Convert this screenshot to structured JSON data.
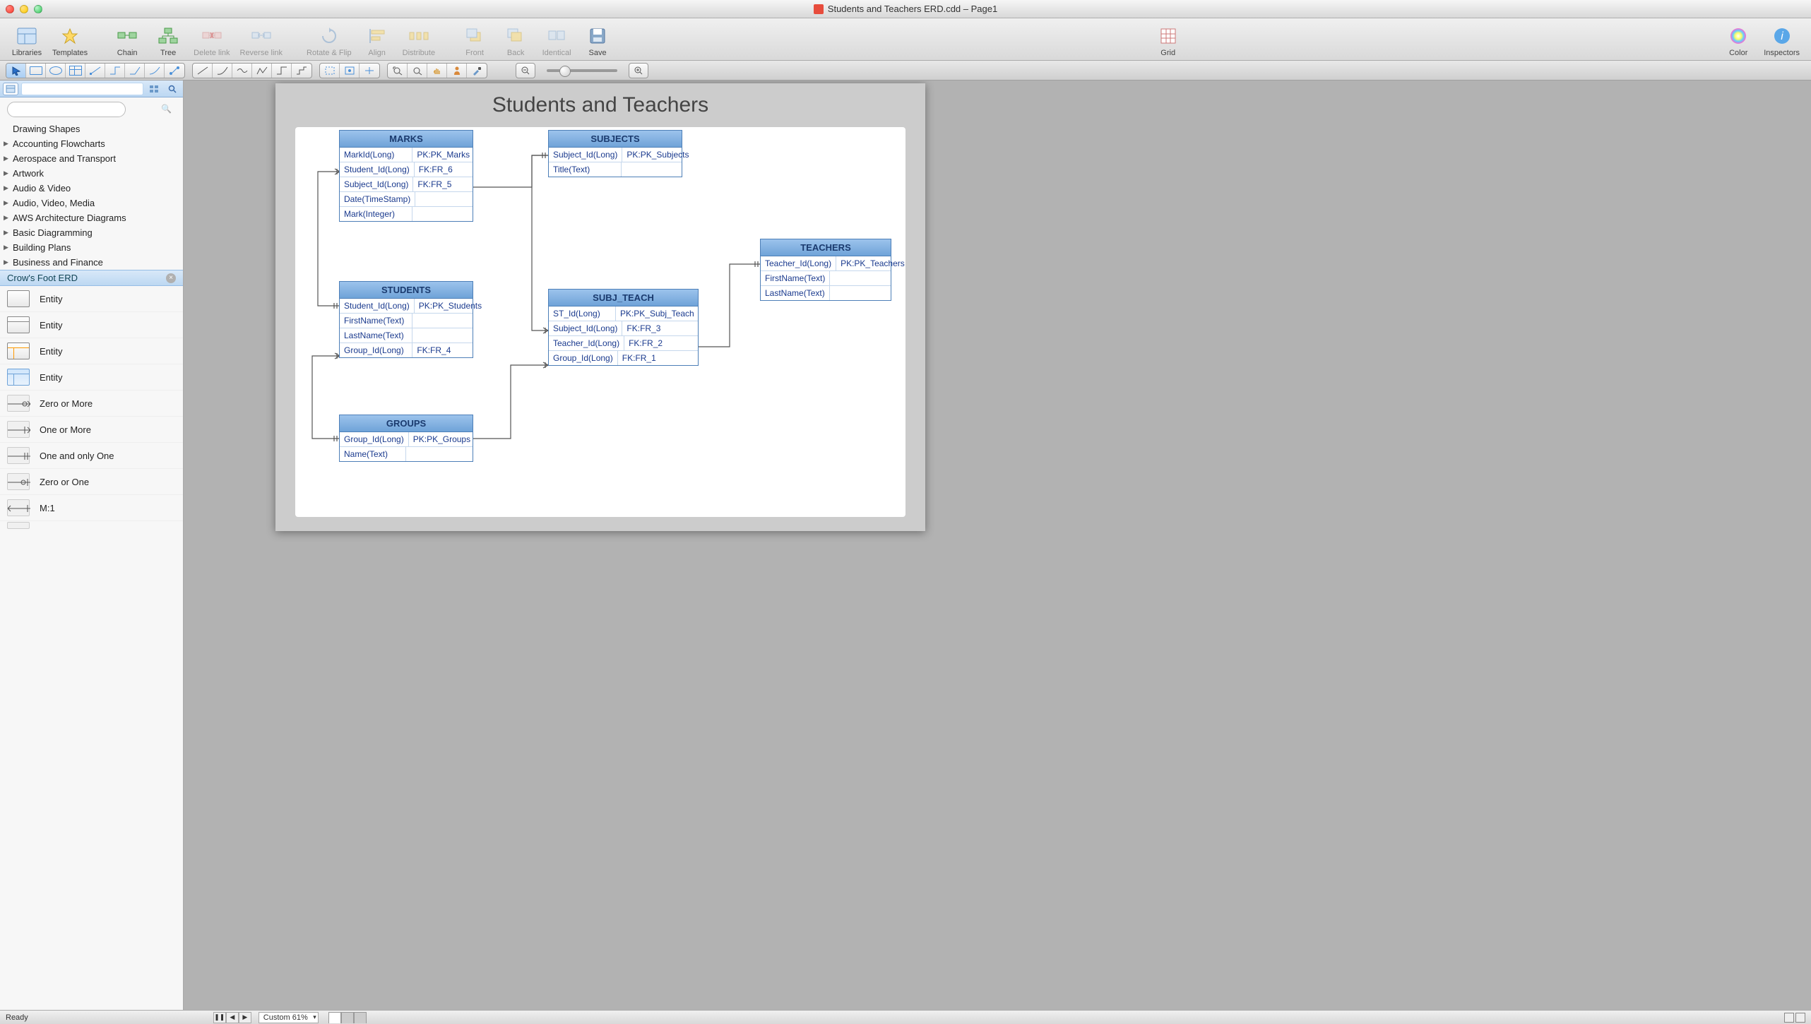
{
  "window": {
    "title": "Students and Teachers ERD.cdd – Page1"
  },
  "toolbar": [
    {
      "id": "libraries",
      "label": "Libraries",
      "enabled": true
    },
    {
      "id": "templates",
      "label": "Templates",
      "enabled": true
    },
    {
      "id": "chain",
      "label": "Chain",
      "enabled": true
    },
    {
      "id": "tree",
      "label": "Tree",
      "enabled": true
    },
    {
      "id": "delete-link",
      "label": "Delete link",
      "enabled": false
    },
    {
      "id": "reverse-link",
      "label": "Reverse link",
      "enabled": false
    },
    {
      "id": "rotate-flip",
      "label": "Rotate & Flip",
      "enabled": false
    },
    {
      "id": "align",
      "label": "Align",
      "enabled": false
    },
    {
      "id": "distribute",
      "label": "Distribute",
      "enabled": false
    },
    {
      "id": "front",
      "label": "Front",
      "enabled": false
    },
    {
      "id": "back",
      "label": "Back",
      "enabled": false
    },
    {
      "id": "identical",
      "label": "Identical",
      "enabled": false
    },
    {
      "id": "save",
      "label": "Save",
      "enabled": true
    },
    {
      "id": "grid",
      "label": "Grid",
      "enabled": true
    },
    {
      "id": "color",
      "label": "Color",
      "enabled": true
    },
    {
      "id": "inspectors",
      "label": "Inspectors",
      "enabled": true
    }
  ],
  "sidebar": {
    "search_placeholder": "",
    "top_category": "Drawing Shapes",
    "categories": [
      "Accounting Flowcharts",
      "Aerospace and Transport",
      "Artwork",
      "Audio & Video",
      "Audio, Video, Media",
      "AWS Architecture Diagrams",
      "Basic Diagramming",
      "Building Plans",
      "Business and Finance"
    ],
    "active_library": "Crow's Foot ERD",
    "shapes": [
      {
        "label": "Entity",
        "thumb": "ent1"
      },
      {
        "label": "Entity",
        "thumb": "ent2"
      },
      {
        "label": "Entity",
        "thumb": "ent3"
      },
      {
        "label": "Entity",
        "thumb": "ent4"
      },
      {
        "label": "Zero or More",
        "thumb": "conn-zom"
      },
      {
        "label": "One or More",
        "thumb": "conn-oom"
      },
      {
        "label": "One and only One",
        "thumb": "conn-one"
      },
      {
        "label": "Zero or One",
        "thumb": "conn-zoo"
      },
      {
        "label": "M:1",
        "thumb": "conn-m1"
      }
    ]
  },
  "diagram": {
    "title": "Students and Teachers",
    "entities": {
      "marks": {
        "name": "MARKS",
        "rows": [
          {
            "c1": "MarkId(Long)",
            "c2": "PK:PK_Marks"
          },
          {
            "c1": "Student_Id(Long)",
            "c2": "FK:FR_6"
          },
          {
            "c1": "Subject_Id(Long)",
            "c2": "FK:FR_5"
          },
          {
            "c1": "Date(TimeStamp)",
            "c2": ""
          },
          {
            "c1": "Mark(Integer)",
            "c2": ""
          }
        ]
      },
      "subjects": {
        "name": "SUBJECTS",
        "rows": [
          {
            "c1": "Subject_Id(Long)",
            "c2": "PK:PK_Subjects"
          },
          {
            "c1": "Title(Text)",
            "c2": ""
          }
        ]
      },
      "students": {
        "name": "STUDENTS",
        "rows": [
          {
            "c1": "Student_Id(Long)",
            "c2": "PK:PK_Students"
          },
          {
            "c1": "FirstName(Text)",
            "c2": ""
          },
          {
            "c1": "LastName(Text)",
            "c2": ""
          },
          {
            "c1": "Group_Id(Long)",
            "c2": "FK:FR_4"
          }
        ]
      },
      "subj_teach": {
        "name": "SUBJ_TEACH",
        "rows": [
          {
            "c1": "ST_Id(Long)",
            "c2": "PK:PK_Subj_Teach"
          },
          {
            "c1": "Subject_Id(Long)",
            "c2": "FK:FR_3"
          },
          {
            "c1": "Teacher_Id(Long)",
            "c2": "FK:FR_2"
          },
          {
            "c1": "Group_Id(Long)",
            "c2": "FK:FR_1"
          }
        ]
      },
      "teachers": {
        "name": "TEACHERS",
        "rows": [
          {
            "c1": "Teacher_Id(Long)",
            "c2": "PK:PK_Teachers"
          },
          {
            "c1": "FirstName(Text)",
            "c2": ""
          },
          {
            "c1": "LastName(Text)",
            "c2": ""
          }
        ]
      },
      "groups": {
        "name": "GROUPS",
        "rows": [
          {
            "c1": "Group_Id(Long)",
            "c2": "PK:PK_Groups"
          },
          {
            "c1": "Name(Text)",
            "c2": ""
          }
        ]
      }
    }
  },
  "statusbar": {
    "ready": "Ready",
    "zoom": "Custom 61%"
  }
}
